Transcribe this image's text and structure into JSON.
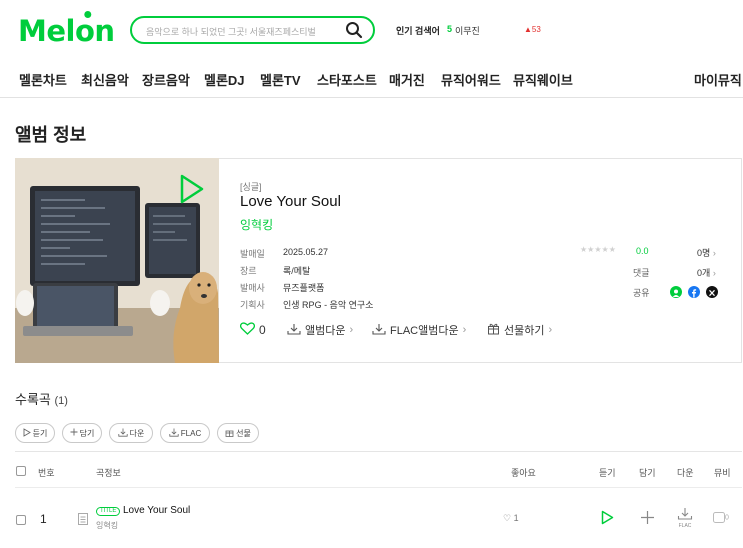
{
  "header": {
    "logo": "Melon",
    "search_placeholder": "음악으로 하나 되었던 그곳! 서울재즈페스티벌",
    "hot_label": "인기 검색어",
    "hot_rank": "5",
    "hot_word": "이무진",
    "hot_change": "▲53"
  },
  "gnb": [
    "멜론차트",
    "최신음악",
    "장르음악",
    "멜론DJ",
    "멜론TV",
    "스타포스트",
    "매거진",
    "뮤직어워드",
    "뮤직웨이브"
  ],
  "gnb_right": "마이뮤직",
  "page_title": "앨범 정보",
  "album": {
    "type": "[싱글]",
    "title": "Love Your Soul",
    "artist": "잉혁킹",
    "meta": [
      {
        "key": "발매일",
        "value": "2025.05.27"
      },
      {
        "key": "장르",
        "value": "록/메탈"
      },
      {
        "key": "발매사",
        "value": "뮤즈플랫폼"
      },
      {
        "key": "기획사",
        "value": "인생 RPG - 음악 연구소"
      }
    ],
    "rating": "0.0",
    "rating_count": "0명",
    "comment_label": "댓글",
    "comment_count": "0개",
    "share_label": "공유",
    "like_count": "0",
    "actions": [
      "앨범다운",
      "FLAC앨범다운",
      "선물하기"
    ]
  },
  "tracklist": {
    "title": "수록곡",
    "count": "(1)",
    "buttons": [
      "듣기",
      "담기",
      "다운",
      "FLAC",
      "선물"
    ],
    "columns": [
      "번호",
      "곡정보",
      "좋아요",
      "듣기",
      "담기",
      "다운",
      "뮤비"
    ],
    "rows": [
      {
        "num": "1",
        "badge": "TITLE",
        "title": "Love Your Soul",
        "artist": "잉혁킹",
        "likes": "1",
        "flac": "FLAC",
        "mv": "0"
      }
    ]
  },
  "colors": {
    "brand": "#00cd3c"
  }
}
